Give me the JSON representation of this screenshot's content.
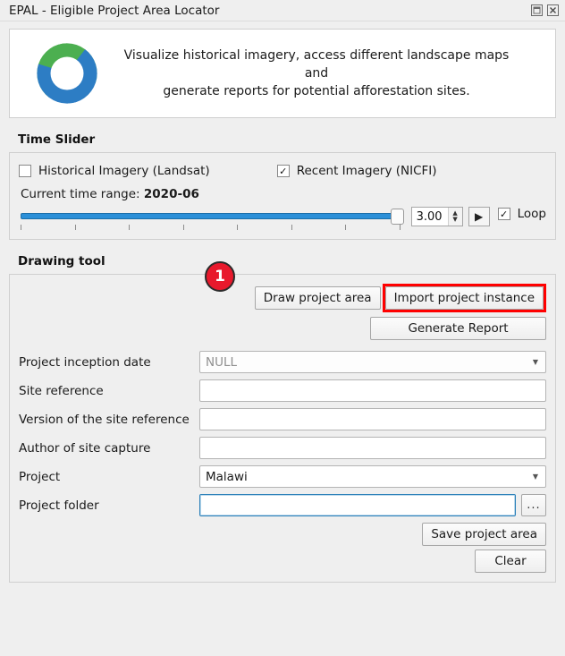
{
  "window": {
    "title": "EPAL - Eligible Project Area Locator",
    "controls": [
      {
        "name": "float-icon",
        "label": "Float"
      },
      {
        "name": "close-icon",
        "label": "Close"
      }
    ]
  },
  "banner": {
    "logo_alt": "epal-logo",
    "logo_colors": {
      "green": "#4caf50",
      "blue": "#2d7dc4"
    },
    "line1": "Visualize historical imagery, access different landscape maps and",
    "line2": "generate reports for potential afforestation sites."
  },
  "time_slider": {
    "group_title": "Time Slider",
    "historical": {
      "label": "Historical Imagery (Landsat)",
      "checked": false,
      "mark": ""
    },
    "recent": {
      "label": "Recent Imagery (NICFI)",
      "checked": true,
      "mark": "✓"
    },
    "current_time_label": "Current time range:",
    "current_time_value": "2020-06",
    "slider": {
      "value": 100,
      "min": 0,
      "max": 100,
      "ticks": 8
    },
    "speed_value": "3.00",
    "play_label": "▶",
    "loop": {
      "label": "Loop",
      "checked": true,
      "mark": "✓"
    }
  },
  "drawing_tool": {
    "group_title": "Drawing tool",
    "draw_button": "Draw project area",
    "import_button": "Import project instance",
    "generate_button": "Generate Report",
    "badge": "1",
    "badge_color": "#e8192c",
    "highlight_color": "#ff0000",
    "fields": [
      {
        "label": "Project inception date",
        "type": "combo",
        "value": "NULL",
        "placeholder": true,
        "disabled": true
      },
      {
        "label": "Site reference",
        "type": "input",
        "value": "",
        "placeholder": ""
      },
      {
        "label": "Version of the site reference",
        "type": "input",
        "value": "",
        "placeholder": ""
      },
      {
        "label": "Author of site capture",
        "type": "input",
        "value": "",
        "placeholder": ""
      },
      {
        "label": "Project",
        "type": "combo",
        "value": "Malawi",
        "placeholder": false,
        "disabled": false
      },
      {
        "label": "Project folder",
        "type": "input-browse",
        "value": "",
        "placeholder": "",
        "focused": true,
        "browse_label": "..."
      }
    ],
    "save_button": "Save project area",
    "clear_button": "Clear"
  }
}
